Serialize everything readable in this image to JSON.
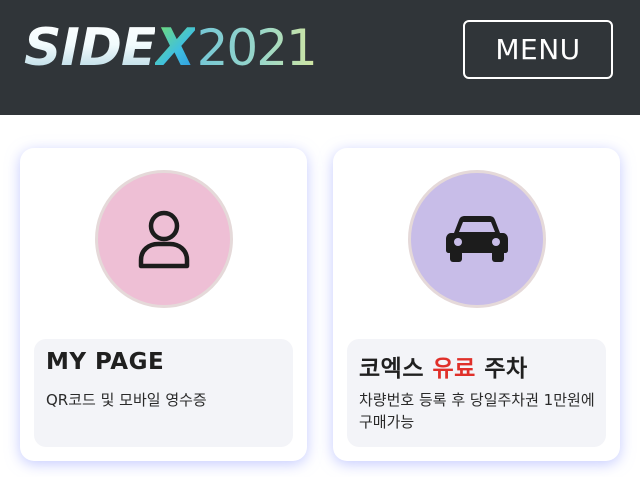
{
  "header": {
    "logo": {
      "text_main": "SIDE",
      "text_x": "X",
      "text_year": "2021"
    },
    "menu_label": "MENU"
  },
  "cards": [
    {
      "icon": "user-icon",
      "title": "MY PAGE",
      "description": "QR코드 및 모바일 영수증",
      "circle_color": "#eebfd5"
    },
    {
      "icon": "car-icon",
      "title_before": "코엑스 ",
      "title_highlight": "유료",
      "title_after": " 주차",
      "highlight_color": "#e0302a",
      "description": "차량번호 등록 후 당일주차권 1만원에 구매가능",
      "circle_color": "#c8bde8"
    }
  ],
  "colors": {
    "header_bg": "#303539",
    "card_shadow": "#96a0ff"
  }
}
